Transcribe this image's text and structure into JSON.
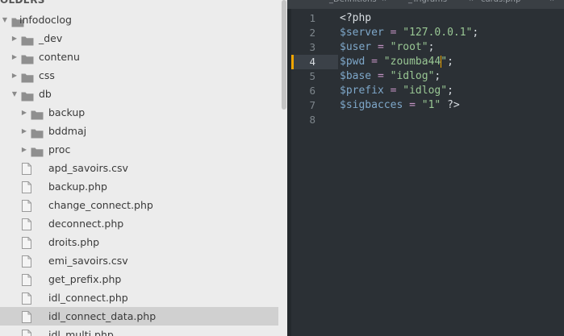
{
  "sidebar": {
    "header": "OLDERS",
    "items": [
      {
        "label": "infodoclog",
        "type": "folder",
        "state": "open",
        "depth": 0
      },
      {
        "label": "_dev",
        "type": "folder",
        "state": "closed",
        "depth": 1
      },
      {
        "label": "contenu",
        "type": "folder",
        "state": "closed",
        "depth": 1
      },
      {
        "label": "css",
        "type": "folder",
        "state": "closed",
        "depth": 1
      },
      {
        "label": "db",
        "type": "folder",
        "state": "open",
        "depth": 1
      },
      {
        "label": "backup",
        "type": "folder",
        "state": "closed",
        "depth": 2
      },
      {
        "label": "bddmaj",
        "type": "folder",
        "state": "closed",
        "depth": 2
      },
      {
        "label": "proc",
        "type": "folder",
        "state": "closed",
        "depth": 2
      },
      {
        "label": "apd_savoirs.csv",
        "type": "file",
        "depth": 2
      },
      {
        "label": "backup.php",
        "type": "file",
        "depth": 2
      },
      {
        "label": "change_connect.php",
        "type": "file",
        "depth": 2
      },
      {
        "label": "deconnect.php",
        "type": "file",
        "depth": 2
      },
      {
        "label": "droits.php",
        "type": "file",
        "depth": 2
      },
      {
        "label": "emi_savoirs.csv",
        "type": "file",
        "depth": 2
      },
      {
        "label": "get_prefix.php",
        "type": "file",
        "depth": 2
      },
      {
        "label": "idl_connect.php",
        "type": "file",
        "depth": 2
      },
      {
        "label": "idl_connect_data.php",
        "type": "file",
        "depth": 2,
        "selected": true
      },
      {
        "label": "idl_multi.php",
        "type": "file",
        "depth": 2
      }
    ]
  },
  "editor": {
    "tabs": [
      {
        "label": "_Definitions",
        "close": "×"
      },
      {
        "label": "_Trigrams",
        "close": "×"
      },
      {
        "label": "cards.php",
        "close": "×"
      }
    ],
    "active_line": 4,
    "code": [
      {
        "line": "1",
        "tokens": [
          {
            "t": "<?php",
            "k": "plain"
          }
        ]
      },
      {
        "line": "2",
        "tokens": [
          {
            "t": "$server",
            "k": "var"
          },
          {
            "t": " = ",
            "k": "op"
          },
          {
            "t": "\"127.0.0.1\"",
            "k": "str"
          },
          {
            "t": ";",
            "k": "plain"
          }
        ]
      },
      {
        "line": "3",
        "tokens": [
          {
            "t": "$user",
            "k": "var"
          },
          {
            "t": " = ",
            "k": "op"
          },
          {
            "t": "\"root\"",
            "k": "str"
          },
          {
            "t": ";",
            "k": "plain"
          }
        ]
      },
      {
        "line": "4",
        "tokens": [
          {
            "t": "$pwd",
            "k": "var"
          },
          {
            "t": " = ",
            "k": "op"
          },
          {
            "t": "\"zoumba44",
            "k": "str"
          },
          {
            "t": "",
            "k": "caret"
          },
          {
            "t": "\"",
            "k": "str"
          },
          {
            "t": ";",
            "k": "plain"
          }
        ]
      },
      {
        "line": "5",
        "tokens": [
          {
            "t": "$base",
            "k": "var"
          },
          {
            "t": " = ",
            "k": "op"
          },
          {
            "t": "\"idlog\"",
            "k": "str"
          },
          {
            "t": ";",
            "k": "plain"
          }
        ]
      },
      {
        "line": "6",
        "tokens": [
          {
            "t": "$prefix",
            "k": "var"
          },
          {
            "t": " = ",
            "k": "op"
          },
          {
            "t": "\"idlog\"",
            "k": "str"
          },
          {
            "t": ";",
            "k": "plain"
          }
        ]
      },
      {
        "line": "7",
        "tokens": [
          {
            "t": "$sigbacces",
            "k": "var"
          },
          {
            "t": " = ",
            "k": "op"
          },
          {
            "t": "\"1\"",
            "k": "str"
          },
          {
            "t": " ?>",
            "k": "plain"
          }
        ]
      },
      {
        "line": "8",
        "tokens": []
      }
    ]
  }
}
